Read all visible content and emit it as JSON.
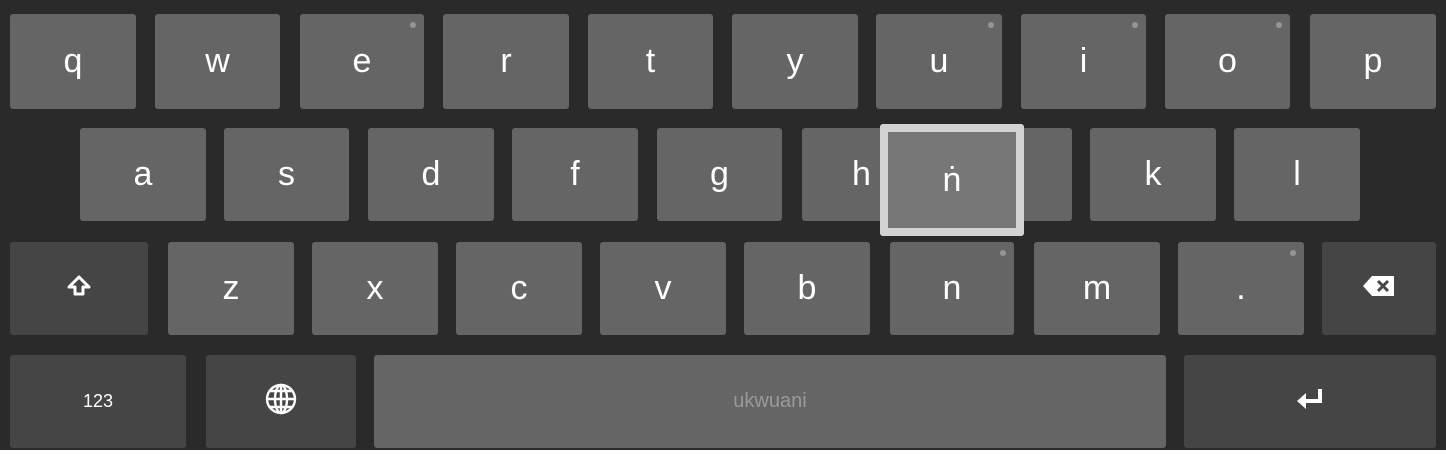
{
  "keyboard": {
    "row1": [
      {
        "label": "q"
      },
      {
        "label": "w"
      },
      {
        "label": "e",
        "hint": true
      },
      {
        "label": "r"
      },
      {
        "label": "t"
      },
      {
        "label": "y"
      },
      {
        "label": "u",
        "hint": true
      },
      {
        "label": "i",
        "hint": true
      },
      {
        "label": "o",
        "hint": true
      },
      {
        "label": "p"
      }
    ],
    "row2": [
      {
        "label": "a"
      },
      {
        "label": "s"
      },
      {
        "label": "d"
      },
      {
        "label": "f"
      },
      {
        "label": "g"
      },
      {
        "label": "h"
      },
      {
        "label": "k"
      },
      {
        "label": "l"
      }
    ],
    "row3": [
      {
        "label": "z"
      },
      {
        "label": "x"
      },
      {
        "label": "c"
      },
      {
        "label": "v"
      },
      {
        "label": "b"
      },
      {
        "label": "n",
        "hint": true
      },
      {
        "label": "m"
      },
      {
        "label": ".",
        "hint": true
      }
    ],
    "popup_char": "ṅ",
    "numbers_label": "123",
    "space_label": "ukwuani",
    "icons": {
      "shift": "shift-icon",
      "backspace": "backspace-icon",
      "globe": "globe-icon",
      "enter": "enter-icon"
    },
    "colors": {
      "background": "#2a2a2a",
      "character_key": "#656565",
      "function_key": "#454545",
      "popup_border": "#d2d2d2",
      "popup_fill": "#777777",
      "space_text": "#9a9a9a"
    }
  }
}
